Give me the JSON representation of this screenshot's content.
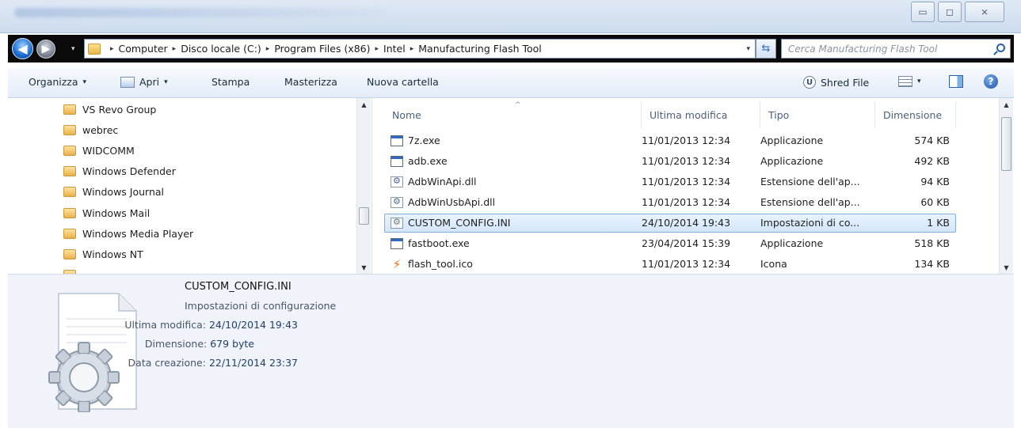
{
  "window": {
    "controls": {
      "minimize": "▭",
      "maximize": "◻",
      "close": "⨯"
    }
  },
  "address_bar": {
    "back_icon": "arrow-left",
    "forward_icon": "arrow-right",
    "path": [
      "Computer",
      "Disco locale (C:)",
      "Program Files (x86)",
      "Intel",
      "Manufacturing Flash Tool"
    ],
    "separator": "▸",
    "dropdown": "▾",
    "refresh_glyph": "⇆",
    "search_placeholder": "Cerca Manufacturing Flash Tool"
  },
  "toolbar": {
    "organizza": "Organizza",
    "apri": "Apri",
    "stampa": "Stampa",
    "masterizza": "Masterizza",
    "nuova_cartella": "Nuova cartella",
    "shred_file": "Shred File",
    "caret": "▾",
    "help": "?"
  },
  "nav_tree": {
    "items": [
      {
        "label": "VS Revo Group"
      },
      {
        "label": "webrec"
      },
      {
        "label": "WIDCOMM"
      },
      {
        "label": "Windows Defender"
      },
      {
        "label": "Windows Journal"
      },
      {
        "label": "Windows Mail"
      },
      {
        "label": "Windows Media Player"
      },
      {
        "label": "Windows NT"
      }
    ]
  },
  "file_list": {
    "columns": {
      "name": "Nome",
      "modified": "Ultima modifica",
      "type": "Tipo",
      "size": "Dimensione"
    },
    "sort_glyph": "^",
    "rows": [
      {
        "name": "7z.exe",
        "icon": "exe-icon",
        "modified": "11/01/2013 12:34",
        "type": "Applicazione",
        "size": "574 KB",
        "selected": false
      },
      {
        "name": "adb.exe",
        "icon": "exe-icon",
        "modified": "11/01/2013 12:34",
        "type": "Applicazione",
        "size": "492 KB",
        "selected": false
      },
      {
        "name": "AdbWinApi.dll",
        "icon": "dll-icon",
        "modified": "11/01/2013 12:34",
        "type": "Estensione dell'ap...",
        "size": "94 KB",
        "selected": false
      },
      {
        "name": "AdbWinUsbApi.dll",
        "icon": "dll-icon",
        "modified": "11/01/2013 12:34",
        "type": "Estensione dell'ap...",
        "size": "60 KB",
        "selected": false
      },
      {
        "name": "CUSTOM_CONFIG.INI",
        "icon": "ini-icon",
        "modified": "24/10/2014 19:43",
        "type": "Impostazioni di co...",
        "size": "1 KB",
        "selected": true
      },
      {
        "name": "fastboot.exe",
        "icon": "exe-icon",
        "modified": "23/04/2014 15:39",
        "type": "Applicazione",
        "size": "518 KB",
        "selected": false
      },
      {
        "name": "flash_tool.ico",
        "icon": "ico-icon",
        "modified": "11/01/2013 12:34",
        "type": "Icona",
        "size": "134 KB",
        "selected": false
      }
    ]
  },
  "details_pane": {
    "file_name": "CUSTOM_CONFIG.INI",
    "file_type": "Impostazioni di configurazione",
    "modified_label": "Ultima modifica:",
    "modified_value": "24/10/2014 19:43",
    "size_label": "Dimensione:",
    "size_value": "679 byte",
    "created_label": "Data creazione:",
    "created_value": "22/11/2014 23:37"
  },
  "colors": {
    "selection_fill": "#d3e6fa",
    "selection_border": "#84acdd",
    "details_bg": "#f0f4fa",
    "link_blue": "#1e3e6b"
  }
}
